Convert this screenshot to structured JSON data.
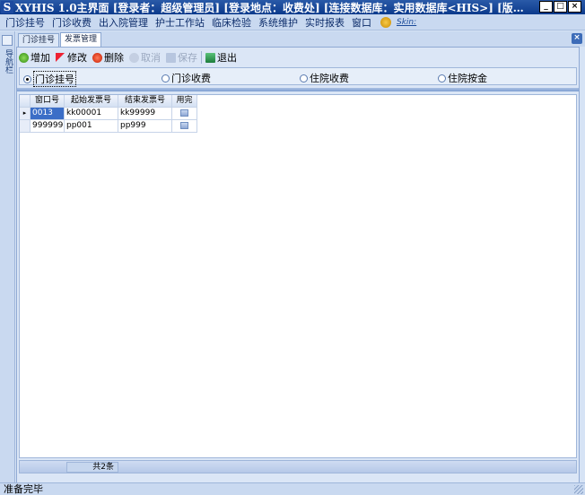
{
  "window": {
    "title": "XYHIS 1.0主界面   [登录者：超级管理员] [登录地点：收费处] [连接数据库：实用数据库<HIS>] [版…",
    "logo_letter": "S",
    "min": "_",
    "max": "□",
    "close": "×"
  },
  "menu": {
    "items": [
      "门诊挂号",
      "门诊收费",
      "出入院管理",
      "护士工作站",
      "临床检验",
      "系统维护",
      "实时报表",
      "窗口"
    ],
    "skin_label": "Skin:"
  },
  "left_strip": {
    "label": "导航栏"
  },
  "tabs": [
    {
      "label": "门诊挂号"
    },
    {
      "label": "发票管理"
    }
  ],
  "tab_close": "×",
  "toolbar": {
    "add": "增加",
    "edit": "修改",
    "delete": "删除",
    "cancel": "取消",
    "save": "保存",
    "exit": "退出"
  },
  "radios": [
    "门诊挂号",
    "门诊收费",
    "住院收费",
    "住院按金"
  ],
  "grid": {
    "headers": [
      "窗口号",
      "起始发票号",
      "结束发票号",
      "用完"
    ],
    "rows": [
      {
        "window_no": "0013",
        "start": "kk00001",
        "end": "kk99999"
      },
      {
        "window_no": "999999",
        "start": "pp001",
        "end": "pp999"
      }
    ],
    "row_marker": "▸"
  },
  "footer": {
    "count": "共2条"
  },
  "status": {
    "text": "准备完毕"
  }
}
